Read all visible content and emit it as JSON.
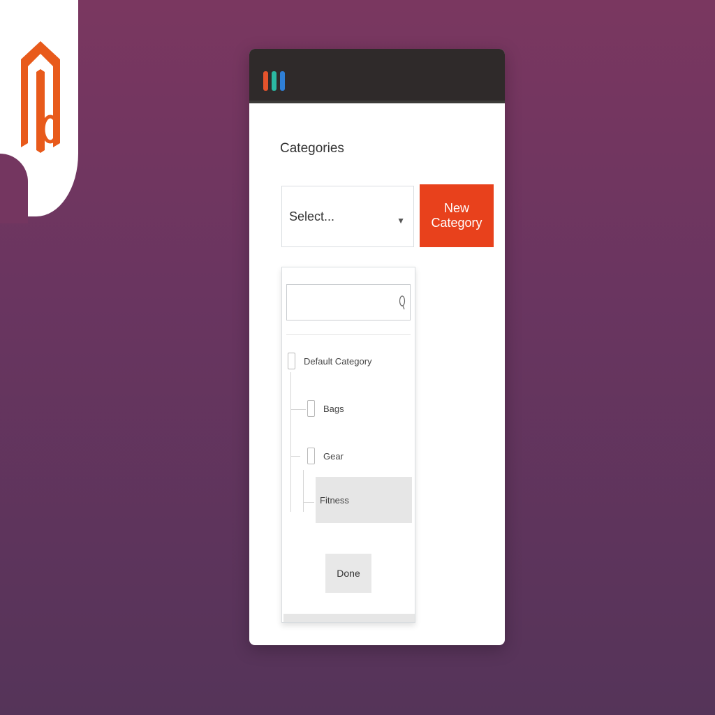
{
  "form": {
    "heading": "Categories",
    "select_value": "Select...",
    "new_category_label": "New Category"
  },
  "dropdown": {
    "search_value": "",
    "items": [
      {
        "label": "Default Category",
        "selected": false
      },
      {
        "label": "Gear",
        "selected": false
      },
      {
        "label": "Bags",
        "selected": false
      },
      {
        "label": "Fitness",
        "selected": true
      }
    ],
    "done_label": "Done"
  },
  "colors": {
    "background_top": "#7a3760",
    "background_bottom": "#553459",
    "accent": "#e8411c",
    "titlebar": "#2f2a2a",
    "dot_orange": "#e5532c",
    "dot_teal": "#2bb8a2",
    "dot_blue": "#2f7fd6"
  },
  "icons": [
    "magento-logo-icon",
    "chevron-down-icon",
    "search-icon"
  ]
}
